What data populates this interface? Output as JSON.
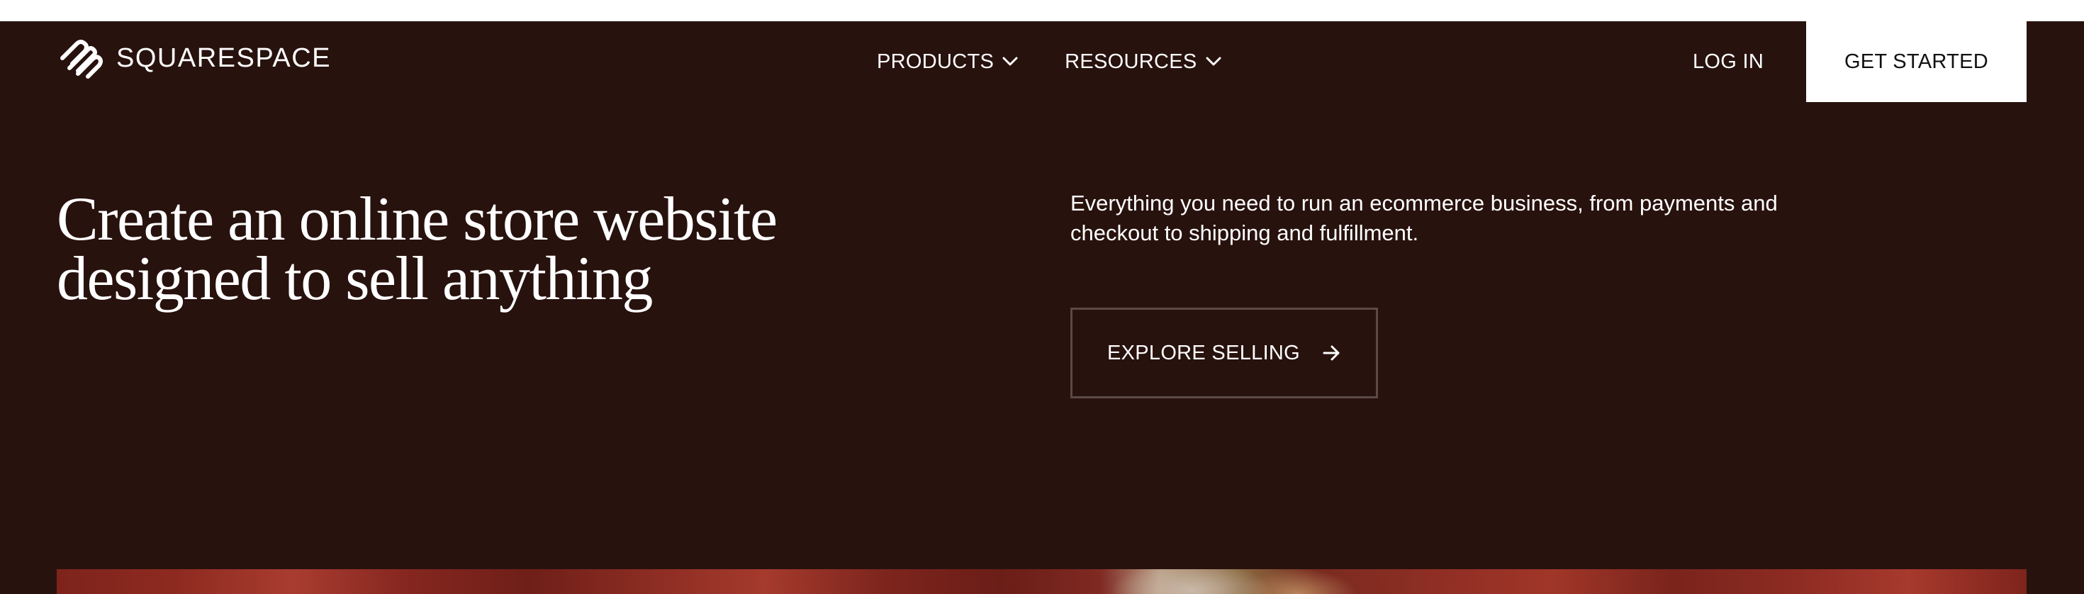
{
  "nav": {
    "brand": "SQUARESPACE",
    "items": [
      {
        "label": "PRODUCTS",
        "icon": "chevron-down-icon"
      },
      {
        "label": "RESOURCES",
        "icon": "chevron-down-icon"
      }
    ],
    "login_label": "LOG IN",
    "cta_label": "GET STARTED"
  },
  "hero": {
    "headline_line1": "Create an online store website",
    "headline_line2": "designed to sell anything",
    "subcopy_line1": "Everything you need to run an ecommerce business, from payments and",
    "subcopy_line2": "checkout to shipping and fulfillment.",
    "button_label": "EXPLORE SELLING",
    "button_icon": "arrow-right-icon"
  },
  "colors": {
    "background": "#28120e",
    "text": "#ffffff",
    "cta_background": "#ffffff",
    "cta_text": "#111111",
    "button_border": "#5b4a46"
  }
}
